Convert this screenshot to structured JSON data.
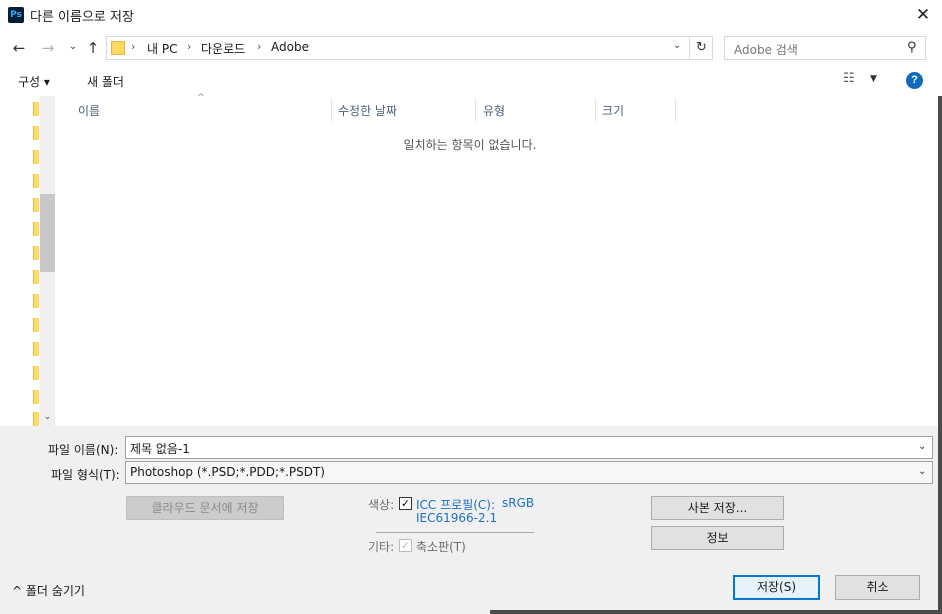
{
  "window": {
    "app_icon": "Ps",
    "title": "다른 이름으로 저장",
    "close_icon": "✕"
  },
  "nav": {
    "back_icon": "←",
    "forward_icon": "→",
    "recent_icon": "⌄",
    "up_icon": "↑",
    "breadcrumb": [
      "내 PC",
      "다운로드",
      "Adobe"
    ],
    "separator": "›",
    "dropdown_icon": "⌄",
    "refresh_icon": "↻",
    "search_placeholder": "Adobe 검색",
    "search_icon": "⚲"
  },
  "toolbar": {
    "organize_label": "구성 ▾",
    "new_folder_label": "새 폴더",
    "view_icon": "☷",
    "view_dropdown_icon": "▼",
    "help_icon": "?"
  },
  "file_list": {
    "columns": [
      "이름",
      "수정한 날짜",
      "유형",
      "크기"
    ],
    "sort_indicator": "^",
    "empty_message": "일치하는 항목이 없습니다.",
    "scroll_down_icon": "⌄"
  },
  "form": {
    "filename_label": "파일 이름(N):",
    "filename_value": "제목 없음-1",
    "filetype_label": "파일 형식(T):",
    "filetype_value": "Photoshop (*.PSD;*.PDD;*.PSDT)",
    "combo_dropdown_icon": "⌄",
    "cloud_button": "클라우드 문서에 저장",
    "color_label": "색상:",
    "icc_label": "ICC 프로필(C):",
    "icc_profile": "sRGB",
    "icc_profile_detail": "IEC61966-2.1",
    "icc_checked": true,
    "other_label": "기타:",
    "thumbnail_label": "축소판(T)",
    "check_glyph": "✓",
    "copy_save_button": "사본 저장...",
    "info_button": "정보",
    "save_button": "저장(S)",
    "cancel_button": "취소",
    "hide_folders_icon": "^",
    "hide_folders_label": "폴더 숨기기"
  },
  "colors": {
    "accent": "#0078d7",
    "link": "#1e6fc4",
    "help": "#0f6cbd",
    "panel": "#f0f0f0"
  }
}
